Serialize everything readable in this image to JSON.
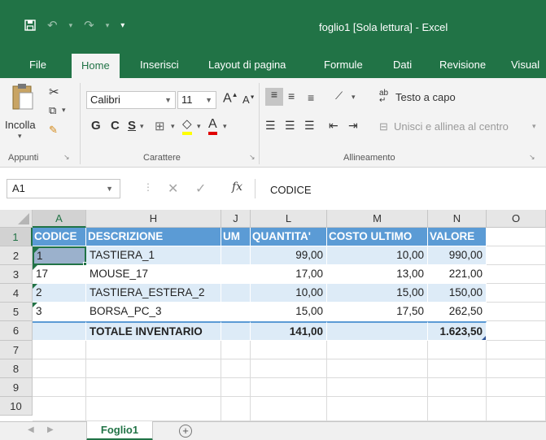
{
  "window": {
    "title": "foglio1  [Sola lettura]  -  Excel",
    "accent": "#217346"
  },
  "quick_access": {
    "save_icon": "save-icon",
    "undo_icon": "undo-icon",
    "redo_icon": "redo-icon",
    "customize_icon": "customize-qat-icon"
  },
  "ribbon_tabs": [
    "File",
    "Home",
    "Inserisci",
    "Layout di pagina",
    "Formule",
    "Dati",
    "Revisione",
    "Visual"
  ],
  "ribbon": {
    "clipboard": {
      "paste": "Incolla",
      "group": "Appunti"
    },
    "font": {
      "family": "Calibri",
      "size": "11",
      "bold": "G",
      "italic": "C",
      "underline": "S",
      "group": "Carattere"
    },
    "alignment": {
      "wrap_text": "Testo a capo",
      "merge_center": "Unisci e allinea al centro",
      "group": "Allineamento"
    }
  },
  "formula_bar": {
    "name_box": "A1",
    "cancel": "✕",
    "enter": "✓",
    "fx": "fx",
    "content": "CODICE"
  },
  "grid": {
    "columns": [
      "A",
      "H",
      "J",
      "L",
      "M",
      "N",
      "O"
    ],
    "rows": [
      "1",
      "2",
      "3",
      "4",
      "5",
      "6",
      "7",
      "8",
      "9",
      "10"
    ],
    "header": [
      "CODICE",
      "DESCRIZIONE",
      "UM",
      "QUANTITA'",
      "COSTO ULTIMO",
      "VALORE"
    ],
    "data": [
      [
        "1",
        "TASTIERA_1",
        "",
        "99,00",
        "10,00",
        "990,00"
      ],
      [
        "17",
        "MOUSE_17",
        "",
        "17,00",
        "13,00",
        "221,00"
      ],
      [
        "2",
        "TASTIERA_ESTERA_2",
        "",
        "10,00",
        "15,00",
        "150,00"
      ],
      [
        "3",
        "BORSA_PC_3",
        "",
        "15,00",
        "17,50",
        "262,50"
      ]
    ],
    "total": [
      "",
      "TOTALE INVENTARIO",
      "",
      "141,00",
      "",
      "1.623,50"
    ],
    "table_header_color": "#5b9bd5",
    "table_band_color": "#ddebf7"
  },
  "sheets": {
    "tabs": [
      "Foglio1"
    ],
    "add": "+"
  }
}
